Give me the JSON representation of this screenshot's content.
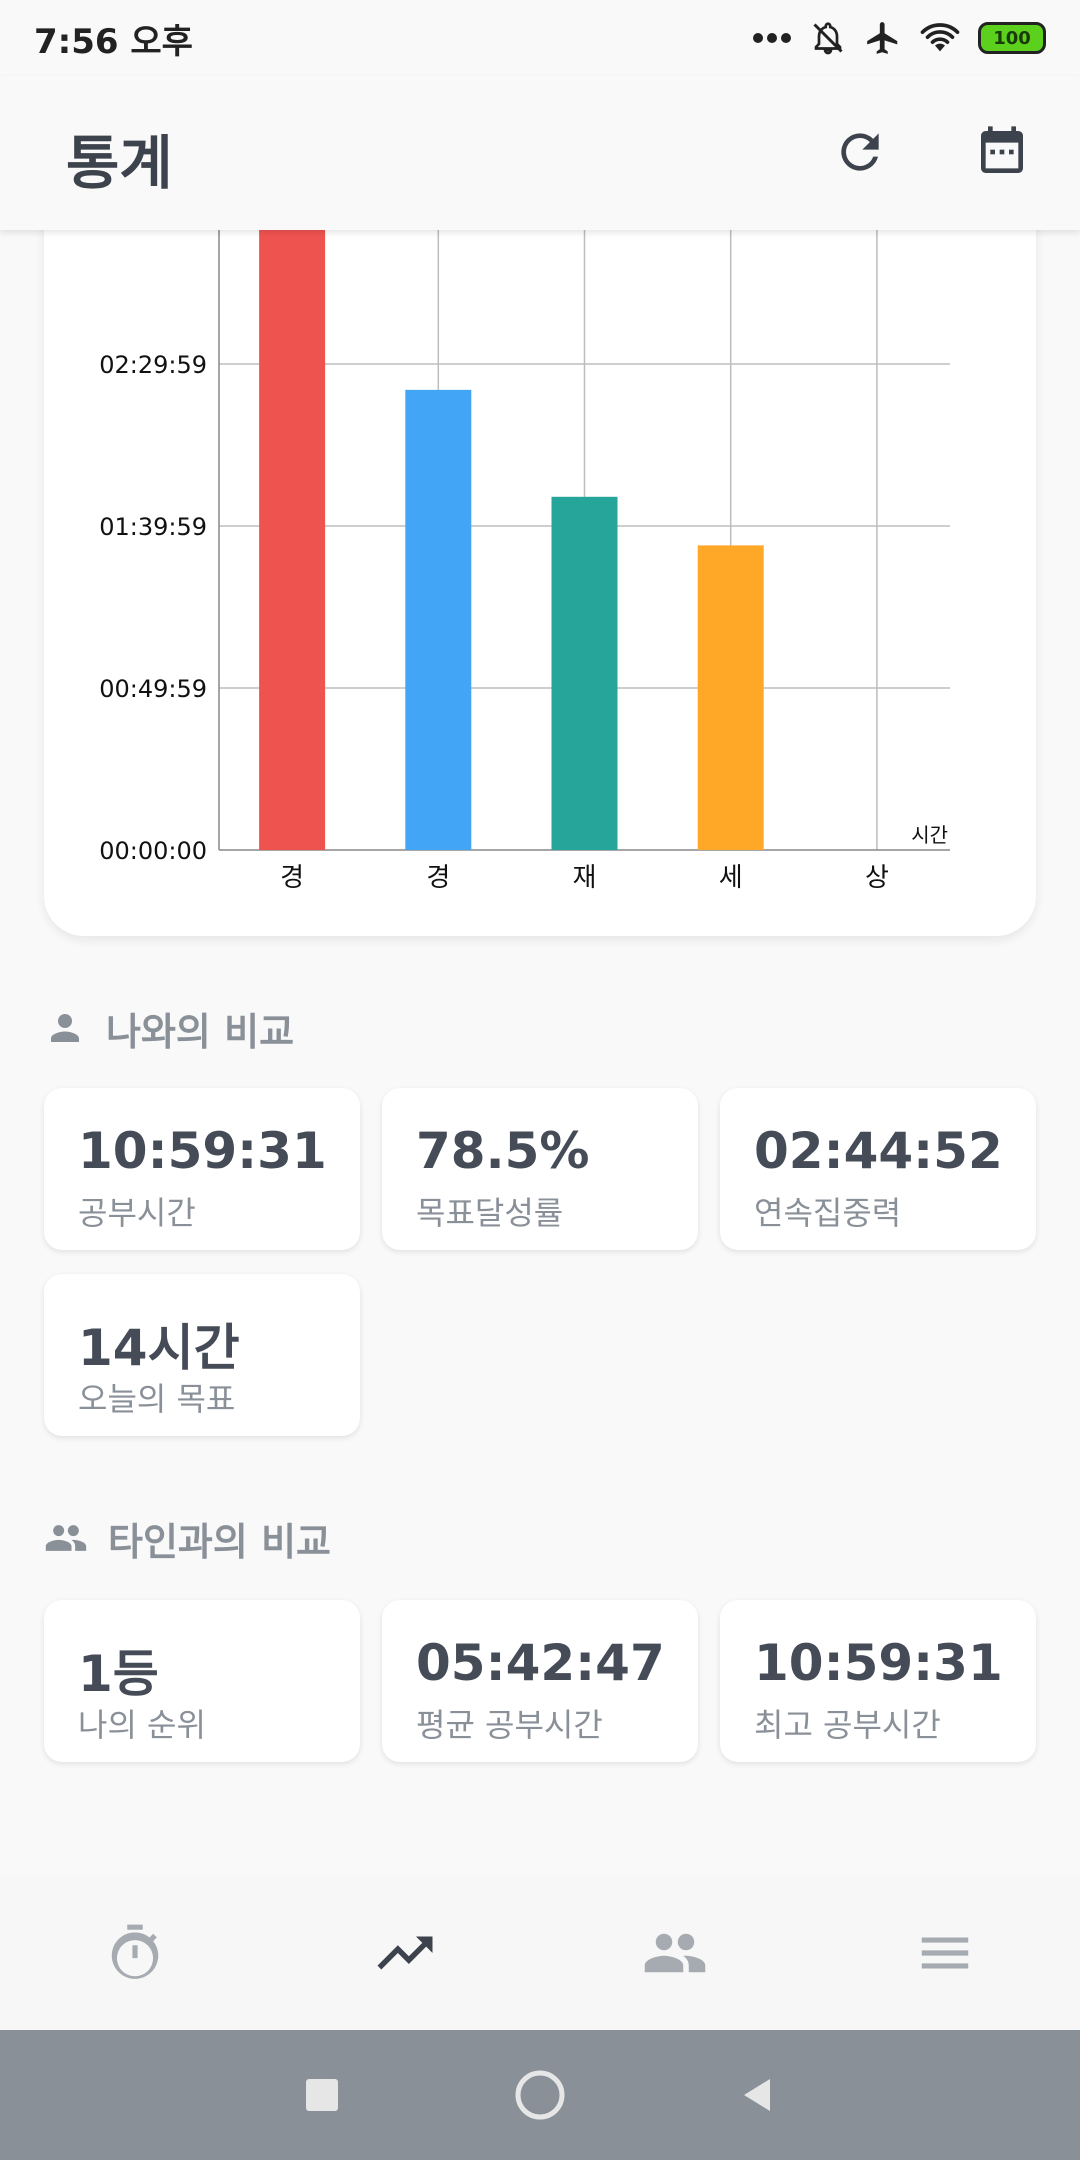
{
  "status_bar": {
    "time": "7:56 오후",
    "battery": "100"
  },
  "app_bar": {
    "title": "통계"
  },
  "chart_data": {
    "type": "bar",
    "categories": [
      "경",
      "경",
      "재",
      "세",
      "상"
    ],
    "values_seconds": [
      11520,
      8520,
      6540,
      5640,
      0
    ],
    "colors": [
      "#EF5350",
      "#42A5F5",
      "#26A69A",
      "#FFA726",
      "#BDBDBD"
    ],
    "y_ticks": [
      "00:00:00",
      "00:49:59",
      "01:39:59",
      "02:29:59"
    ],
    "y_tick_seconds": [
      0,
      2999,
      5999,
      8999
    ],
    "unit_label": "시간",
    "grid": true
  },
  "my_comparison": {
    "title": "나와의 비교",
    "cards": [
      {
        "value": "10:59:31",
        "label": "공부시간"
      },
      {
        "value": "78.5%",
        "label": "목표달성률"
      },
      {
        "value": "02:44:52",
        "label": "연속집중력"
      },
      {
        "value": "14시간",
        "label": "오늘의 목표"
      }
    ]
  },
  "others_comparison": {
    "title": "타인과의 비교",
    "cards": [
      {
        "value": "1등",
        "label": "나의 순위"
      },
      {
        "value": "05:42:47",
        "label": "평균 공부시간"
      },
      {
        "value": "10:59:31",
        "label": "최고 공부시간"
      }
    ]
  },
  "icons": {
    "refresh": "refresh-icon",
    "calendar": "calendar-icon",
    "person": "person-icon",
    "people": "people-icon",
    "timer": "timer-icon",
    "trending": "trending-up-icon",
    "group": "group-icon",
    "menu": "menu-icon"
  }
}
